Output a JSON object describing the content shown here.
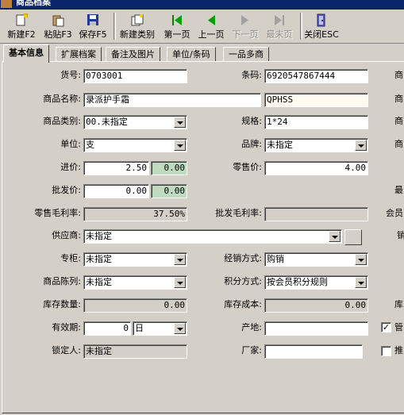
{
  "window": {
    "title": "商品档案"
  },
  "toolbar": {
    "new": "新建F2",
    "paste": "粘贴F3",
    "save": "保存F5",
    "new_category": "新建类别",
    "first": "第一页",
    "prev": "上一页",
    "next": "下一页",
    "last": "最末页",
    "close": "关闭ESC"
  },
  "tabs": [
    "基本信息",
    "扩展档案",
    "备注及图片",
    "单位/条码",
    "一品多商"
  ],
  "form": {
    "code_label": "货号:",
    "code": "0703001",
    "barcode_label": "条码:",
    "barcode": "6920547867444",
    "name_label": "商品名称:",
    "name": "录派护手霜",
    "pinyin": "QPHSS",
    "category_label": "商品类别:",
    "category": "00.未指定",
    "spec_label": "规格:",
    "spec": "1*24",
    "unit_label": "单位:",
    "unit": "支",
    "brand_label": "品牌:",
    "brand": "未指定",
    "cost_label": "进价:",
    "cost": "2.50",
    "cost_extra": "0.00",
    "retail_label": "零售价:",
    "retail": "4.00",
    "wholesale_label": "批发价:",
    "wholesale": "0.00",
    "wholesale_extra": "0.00",
    "retail_margin_label": "零售毛利率:",
    "retail_margin": "37.50%",
    "wholesale_margin_label": "批发毛利率:",
    "wholesale_margin": "",
    "supplier_label": "供应商:",
    "supplier": "未指定",
    "counter_label": "专柜:",
    "counter": "未指定",
    "sale_mode_label": "经销方式:",
    "sale_mode": "购销",
    "display_label": "商品陈列:",
    "display": "未指定",
    "points_label": "积分方式:",
    "points": "按会员积分规则",
    "stock_qty_label": "库存数量:",
    "stock_qty": "0.00",
    "stock_cost_label": "库存成本:",
    "stock_cost": "0.00",
    "validity_label": "有效期:",
    "validity": "0",
    "validity_unit": "日",
    "origin_label": "产地:",
    "origin": "",
    "locker_label": "锁定人:",
    "locker": "未指定",
    "maker_label": "厂家:",
    "maker": ""
  },
  "right_edge": {
    "r1": "商",
    "r2": "商",
    "r3": "商",
    "r4": "商",
    "r5": "最",
    "r6": "会员",
    "r7": "销",
    "r8": "库",
    "check1_label": "管",
    "check1_checked": "✓",
    "check2_label": "推"
  },
  "colors": {
    "title_bar": "#0a246a",
    "face": "#d4d0c8",
    "green_field": "#c0dcc0",
    "cream_field": "#fffbf0"
  }
}
